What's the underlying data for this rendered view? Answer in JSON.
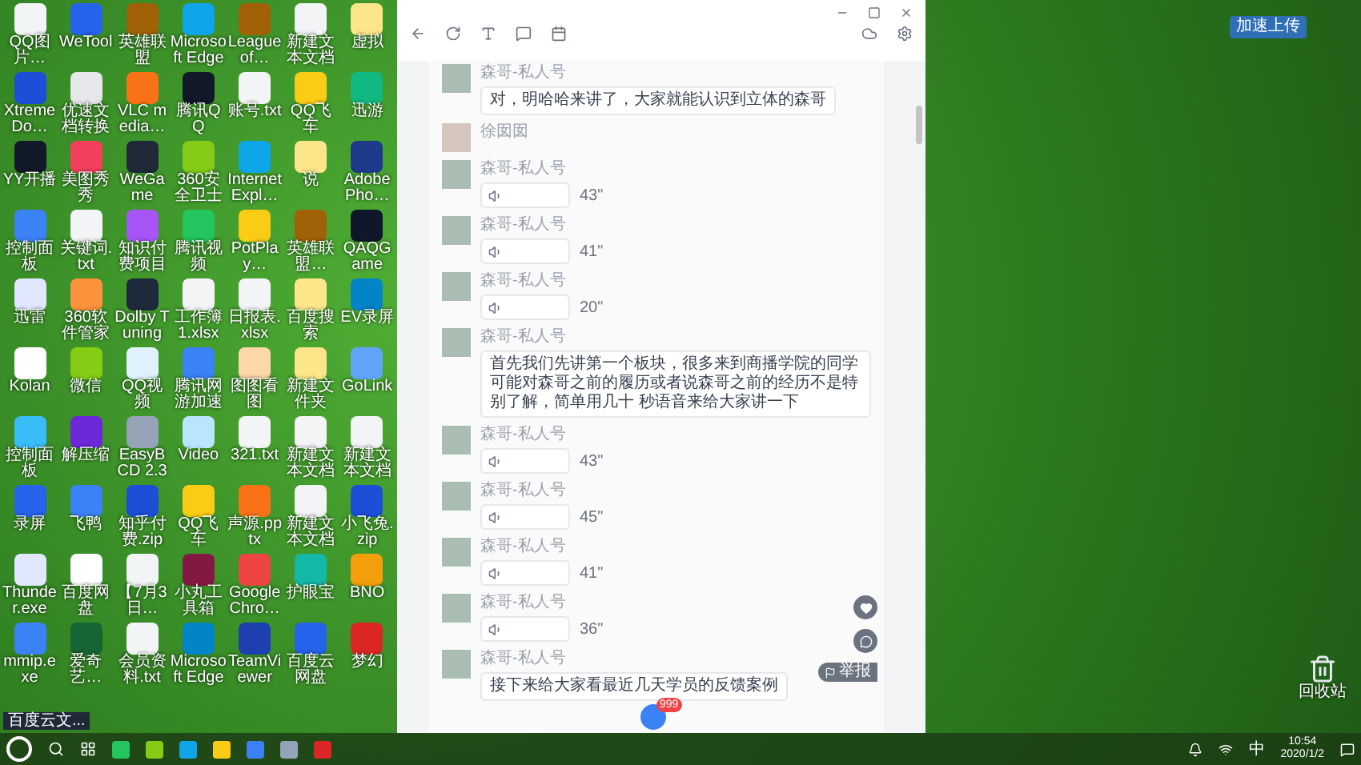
{
  "desktop_icons": [
    {
      "label": "QQ图片…",
      "color": "#f3f4f6"
    },
    {
      "label": "WeTool",
      "color": "#2563eb"
    },
    {
      "label": "英雄联盟",
      "color": "#a16207"
    },
    {
      "label": "Microsoft Edge",
      "color": "#0ea5e9"
    },
    {
      "label": "League of…",
      "color": "#a16207"
    },
    {
      "label": "新建文本文档",
      "color": "#f3f4f6"
    },
    {
      "label": "虚拟",
      "color": "#fde68a"
    },
    {
      "label": "Xtreme Do…",
      "color": "#1d4ed8"
    },
    {
      "label": "优速文档转换",
      "color": "#e5e7eb"
    },
    {
      "label": "VLC media…",
      "color": "#f97316"
    },
    {
      "label": "腾讯QQ",
      "color": "#111827"
    },
    {
      "label": "账号.txt",
      "color": "#f3f4f6"
    },
    {
      "label": "QQ飞车",
      "color": "#facc15"
    },
    {
      "label": "迅游",
      "color": "#10b981"
    },
    {
      "label": "YY开播",
      "color": "#111827"
    },
    {
      "label": "美图秀秀",
      "color": "#f43f5e"
    },
    {
      "label": "WeGame",
      "color": "#1f2937"
    },
    {
      "label": "360安全卫士",
      "color": "#84cc16"
    },
    {
      "label": "Internet Expl…",
      "color": "#0ea5e9"
    },
    {
      "label": "说",
      "color": "#fde68a"
    },
    {
      "label": "Adobe Pho…",
      "color": "#1e3a8a"
    },
    {
      "label": "控制面板",
      "color": "#3b82f6"
    },
    {
      "label": "关键词.txt",
      "color": "#f3f4f6"
    },
    {
      "label": "知识付费项目",
      "color": "#a855f7"
    },
    {
      "label": "腾讯视频",
      "color": "#22c55e"
    },
    {
      "label": "PotPlay…",
      "color": "#facc15"
    },
    {
      "label": "英雄联盟…",
      "color": "#a16207"
    },
    {
      "label": "QAQGame",
      "color": "#0f172a"
    },
    {
      "label": "迅雷",
      "color": "#e0e7ff"
    },
    {
      "label": "360软件管家",
      "color": "#fb923c"
    },
    {
      "label": "Dolby Tuning",
      "color": "#1e293b"
    },
    {
      "label": "工作簿1.xlsx",
      "color": "#f3f4f6"
    },
    {
      "label": "日报表.xlsx",
      "color": "#f3f4f6"
    },
    {
      "label": "百度搜索",
      "color": "#fde68a"
    },
    {
      "label": "EV录屏",
      "color": "#0284c7"
    },
    {
      "label": "Kolan",
      "color": "#ffffff"
    },
    {
      "label": "微信",
      "color": "#84cc16"
    },
    {
      "label": "QQ视频",
      "color": "#e0f2fe"
    },
    {
      "label": "腾讯网游加速",
      "color": "#3b82f6"
    },
    {
      "label": "图图看图",
      "color": "#fed7aa"
    },
    {
      "label": "新建文件夹",
      "color": "#fde68a"
    },
    {
      "label": "GoLink",
      "color": "#60a5fa"
    },
    {
      "label": "控制面板",
      "color": "#38bdf8"
    },
    {
      "label": "解压缩",
      "color": "#6d28d9"
    },
    {
      "label": "EasyBCD 2.3",
      "color": "#94a3b8"
    },
    {
      "label": "Video",
      "color": "#bae6fd"
    },
    {
      "label": "321.txt",
      "color": "#f3f4f6"
    },
    {
      "label": "新建文本文档",
      "color": "#f3f4f6"
    },
    {
      "label": "新建文本文档",
      "color": "#f3f4f6"
    },
    {
      "label": "录屏",
      "color": "#2563eb"
    },
    {
      "label": "飞鸭",
      "color": "#3b82f6"
    },
    {
      "label": "知乎付费.zip",
      "color": "#1d4ed8"
    },
    {
      "label": "QQ飞车",
      "color": "#facc15"
    },
    {
      "label": "声源.pptx",
      "color": "#f97316"
    },
    {
      "label": "新建文本文档",
      "color": "#f3f4f6"
    },
    {
      "label": "小飞兔.zip",
      "color": "#1d4ed8"
    },
    {
      "label": "Thunder.exe",
      "color": "#e0e7ff"
    },
    {
      "label": "百度网盘",
      "color": "#ffffff"
    },
    {
      "label": "【7月3日…",
      "color": "#f3f4f6"
    },
    {
      "label": "小丸工具箱",
      "color": "#831843"
    },
    {
      "label": "Google Chro…",
      "color": "#ef4444"
    },
    {
      "label": "护眼宝",
      "color": "#14b8a6"
    },
    {
      "label": "BNO",
      "color": "#f59e0b"
    },
    {
      "label": "mmip.exe",
      "color": "#3b82f6"
    },
    {
      "label": "爱奇艺…",
      "color": "#166534"
    },
    {
      "label": "会员资料.txt",
      "color": "#f3f4f6"
    },
    {
      "label": "Microsoft Edge",
      "color": "#0284c7"
    },
    {
      "label": "TeamViewer",
      "color": "#1e40af"
    },
    {
      "label": "百度云网盘",
      "color": "#2563eb"
    },
    {
      "label": "梦幻",
      "color": "#dc2626"
    }
  ],
  "chat_window": {
    "messages": [
      {
        "kind": "text",
        "sender": "森哥-私人号",
        "text": "对，明哈哈来讲了，大家就能认识到立体的森哥"
      },
      {
        "kind": "name",
        "sender": "徐囡囡"
      },
      {
        "kind": "voice",
        "sender": "森哥-私人号",
        "duration": "43\""
      },
      {
        "kind": "voice",
        "sender": "森哥-私人号",
        "duration": "41\""
      },
      {
        "kind": "voice",
        "sender": "森哥-私人号",
        "duration": "20\""
      },
      {
        "kind": "text",
        "sender": "森哥-私人号",
        "text": "首先我们先讲第一个板块，很多来到商播学院的同学可能对森哥之前的履历或者说森哥之前的经历不是特别了解，简单用几十 秒语音来给大家讲一下"
      },
      {
        "kind": "voice",
        "sender": "森哥-私人号",
        "duration": "43\""
      },
      {
        "kind": "voice",
        "sender": "森哥-私人号",
        "duration": "45\""
      },
      {
        "kind": "voice",
        "sender": "森哥-私人号",
        "duration": "41\""
      },
      {
        "kind": "voice",
        "sender": "森哥-私人号",
        "duration": "36\""
      },
      {
        "kind": "text",
        "sender": "森哥-私人号",
        "text": "接下来给大家看最近几天学员的反馈案例"
      }
    ],
    "report_label": "举报",
    "badge": "999"
  },
  "upload_button": "加速上传",
  "recycle_bin": "回收站",
  "taskbar": {
    "preview_title": "百度云文...",
    "ime": "中",
    "time": "10:54",
    "date": "2020/1/2"
  }
}
